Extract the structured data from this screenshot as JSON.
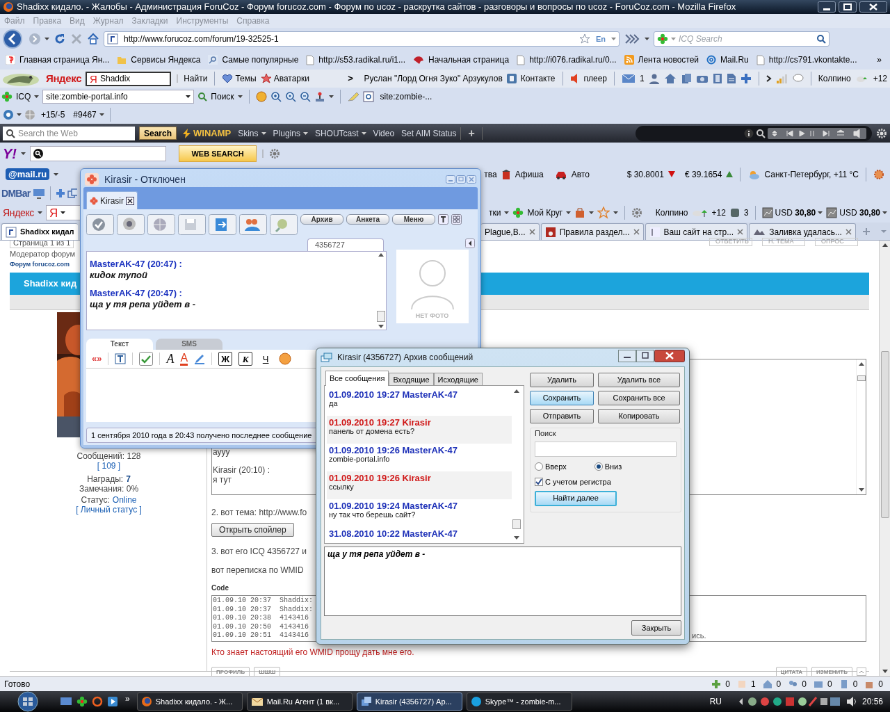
{
  "browser": {
    "title": "Shadixx кидало. - Жалобы - Администрация ForuCoz - Форум forucoz.com - Форум по ucoz - раскрутка сайтов - разговоры и вопросы по ucoz - ForuCoz.com - Mozilla Firefox",
    "menu": [
      "Файл",
      "Правка",
      "Вид",
      "Журнал",
      "Закладки",
      "Инструменты",
      "Справка"
    ],
    "url": "http://www.forucoz.com/forum/19-32525-1",
    "url_lang": "En",
    "search_placeholder": "ICQ Search",
    "bookmarks": [
      "Главная страница Ян...",
      "Сервисы Яндекса",
      "Самые популярные",
      "http://s53.radikal.ru/i1...",
      "Начальная страница",
      "http://i076.radikal.ru/0...",
      "Лента новостей",
      "Mail.Ru",
      "http://cs791.vkontakte..."
    ],
    "bookmarks_more": "»",
    "yandex_bar": {
      "logo": "Яндекс",
      "ya": "Я",
      "search_value": "Shaddix",
      "find": "Найти",
      "items": [
        "Темы",
        "Аватарки"
      ],
      "more": ">",
      "person": "Руслан \"Лорд Огня Зуко\" Арзукулов",
      "vk": "Контакте",
      "player": "плеер",
      "mail_count": "1",
      "city": "Колпино",
      "temp": "+12"
    },
    "icq_bar": {
      "label": "ICQ",
      "query": "site:zombie-portal.info",
      "search": "Поиск",
      "site": "site:zombie-..."
    },
    "rank_bar": {
      "score": "+15/-5",
      "rank": "#9467"
    },
    "winamp_bar": {
      "placeholder": "Search the Web",
      "search": "Search",
      "logo": "WINAMP",
      "menus": [
        "Skins",
        "Plugins",
        "SHOUTcast"
      ],
      "links": [
        "Video",
        "Set AIM Status"
      ],
      "add": "+"
    },
    "yahoo_bar": {
      "logo": "Y!",
      "button": "WEB SEARCH"
    },
    "mailru_bar": {
      "logo": "@mail.ru",
      "fragment": "тва",
      "items": [
        "Афиша",
        "Авто"
      ],
      "usd": "$ 30.8001",
      "eur": "€ 39.1654",
      "weather": "Санкт-Петербург, +11 °C"
    },
    "dm_bar": {
      "logo": "DMBar"
    },
    "yandex_bar2": {
      "logo": "Яндекс",
      "ya": "Я",
      "fragment": "тки",
      "circle": "Мой Круг",
      "city": "Колпино",
      "temp": "+12",
      "count": "3",
      "rates": [
        "USD **30,80**",
        "USD **30,80**"
      ]
    },
    "tabs": [
      {
        "label": "Shadixx кидал",
        "selected": true
      },
      {
        "label": "Plague,B...",
        "selected": false
      },
      {
        "label": "Правила раздел...",
        "selected": false
      },
      {
        "label": "Ваш сайт на стр...",
        "selected": false
      },
      {
        "label": "Заливка удалась...",
        "selected": false
      }
    ],
    "status": "Готово",
    "counters": [
      "0",
      "1",
      "0",
      "0",
      "0",
      "0",
      "0"
    ]
  },
  "forum": {
    "page_info": "Страница 1 из 1",
    "moderator": "Модератор форум",
    "forum_link": "Форум forucoz.com",
    "top_buttons": [
      "ОТВЕТИТЬ",
      "Н. ТЕМА",
      "ОПРОС"
    ],
    "banner": "Shadixx кид",
    "user": {
      "posts": "Сообщений: 128",
      "posts_link": "[ 109 ]",
      "awards_label": "Награды:",
      "awards": "7",
      "warnings": "Замечания: 0%",
      "status_label": "Статус:",
      "status": "Online",
      "personal_status": "[ Личный статус ]"
    },
    "quote_lines": [
      "аууу",
      "Kirasir (20:10) :",
      "я тут"
    ],
    "topic": "2. вот тема: http://www.fo",
    "spoiler_button": "Открыть спойлер",
    "icq": "3. вот его ICQ 4356727 и",
    "wmid": "вот переписка по WMID",
    "code_label": "Code",
    "code_lines": [
      "01.09.10 20:37  Shaddix:",
      "01.09.10 20:37  Shaddix:",
      "01.09.10 20:38  4143416",
      "01.09.10 20:50  4143416",
      "01.09.10 20:51  4143416"
    ],
    "code_tail": "ись.",
    "request": "Кто знает настоящий его WMID прощу дать мне его.",
    "left_buttons": [
      "ПРОФИЛЬ",
      "ШШШ"
    ],
    "right_buttons": [
      "ЦИТАТА",
      "ИЗМЕНИТЬ"
    ]
  },
  "icq_window": {
    "title": "Kirasir - Отключен",
    "tab": "Kirasir",
    "buttons": [
      "Архив",
      "Анкета",
      "Меню"
    ],
    "uin": "4356727",
    "messages": [
      {
        "author": "MasterAK-47 (20:47) :",
        "text": "кидок тупой"
      },
      {
        "author": "MasterAK-47 (20:47) :",
        "text": "ща у тя репа уйдет в -"
      }
    ],
    "photo": "НЕТ ФОТО",
    "input_tabs": [
      {
        "label": "Текст",
        "selected": true
      },
      {
        "label": "SMS",
        "selected": false
      }
    ],
    "quote": "«»",
    "font_buttons": [
      "A",
      "A"
    ],
    "format": [
      "Ж",
      "К",
      "Ч"
    ],
    "status": "1 сентября 2010 года в 20:43 получено последнее сообщение"
  },
  "archive_window": {
    "title": "Kirasir (4356727) Архив сообщений",
    "tabs": [
      {
        "label": "Все сообщения",
        "selected": true
      },
      {
        "label": "Входящие",
        "selected": false
      },
      {
        "label": "Исходящие",
        "selected": false
      }
    ],
    "messages": [
      {
        "kind": "in",
        "header": "01.09.2010 19:27 MasterAK-47",
        "text": "да"
      },
      {
        "kind": "out",
        "header": "01.09.2010 19:27 Kirasir",
        "text": "панель от домена есть?"
      },
      {
        "kind": "in",
        "header": "01.09.2010 19:26 MasterAK-47",
        "text": "zombie-portal.info"
      },
      {
        "kind": "out",
        "header": "01.09.2010 19:26 Kirasir",
        "text": "ссылку"
      },
      {
        "kind": "in",
        "header": "01.09.2010 19:24 MasterAK-47",
        "text": "ну так что берешь сайт?"
      },
      {
        "kind": "in",
        "header": "31.08.2010 10:22 MasterAK-47"
      }
    ],
    "buttons": [
      {
        "label": "Удалить",
        "default": false
      },
      {
        "label": "Удалить все",
        "default": false
      },
      {
        "label": "Сохранить",
        "default": true
      },
      {
        "label": "Сохранить все",
        "default": false
      },
      {
        "label": "Отправить",
        "default": false
      },
      {
        "label": "Копировать",
        "default": false
      }
    ],
    "search_label": "Поиск",
    "directions": [
      {
        "label": "Вверх",
        "selected": false
      },
      {
        "label": "Вниз",
        "selected": true
      }
    ],
    "case": {
      "label": "С учетом регистра",
      "checked": true
    },
    "find": {
      "label": "Найти далее",
      "default": true
    },
    "preview": "ща у тя репа уйдет в -",
    "close": "Закрыть"
  },
  "taskbar": {
    "more": "»",
    "tasks": [
      {
        "label": "Shadixx кидало. - Ж...",
        "selected": false
      },
      {
        "label": "Mail.Ru Агент (1 вк...",
        "selected": false
      },
      {
        "label": "Kirasir (4356727) Ар...",
        "selected": true
      },
      {
        "label": "Skype™ - zombie-m...",
        "selected": false
      }
    ],
    "lang": "RU",
    "time": "20:56"
  }
}
